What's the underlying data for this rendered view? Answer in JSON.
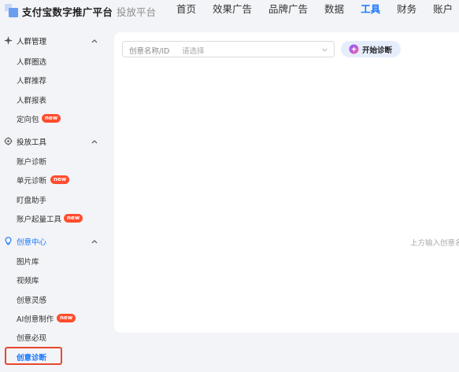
{
  "header": {
    "brand_title": "支付宝数字推广平台",
    "brand_subtitle": "投放平台",
    "nav": [
      {
        "label": "首页",
        "active": false
      },
      {
        "label": "效果广告",
        "active": false
      },
      {
        "label": "品牌广告",
        "active": false
      },
      {
        "label": "数据",
        "active": false
      },
      {
        "label": "工具",
        "active": true
      },
      {
        "label": "财务",
        "active": false
      },
      {
        "label": "账户",
        "active": false
      }
    ]
  },
  "sidebar": {
    "groups": [
      {
        "label": "人群管理",
        "icon": "audience-icon",
        "items": [
          {
            "label": "人群圈选"
          },
          {
            "label": "人群推荐"
          },
          {
            "label": "人群报表"
          },
          {
            "label": "定向包",
            "badge": "new"
          }
        ]
      },
      {
        "label": "投放工具",
        "icon": "tools-icon",
        "items": [
          {
            "label": "账户诊断"
          },
          {
            "label": "单元诊断",
            "badge": "new"
          },
          {
            "label": "盯盘助手"
          },
          {
            "label": "账户起量工具",
            "badge": "new"
          }
        ]
      },
      {
        "label": "创意中心",
        "icon": "bulb-icon",
        "active": true,
        "items": [
          {
            "label": "图片库"
          },
          {
            "label": "视频库"
          },
          {
            "label": "创意灵感"
          },
          {
            "label": "AI创意制作",
            "badge": "new"
          },
          {
            "label": "创意必现"
          },
          {
            "label": "创意诊断",
            "selected": true
          }
        ]
      }
    ]
  },
  "main": {
    "select_label": "创意名称/ID",
    "select_placeholder": "请选择",
    "diagnose_button": "开始诊断",
    "hint": "上方输入创意名"
  },
  "colors": {
    "accent": "#1677ff",
    "badge": "#ff4d2e",
    "highlight_border": "#e8472f",
    "button_bg": "#e6edfd"
  }
}
